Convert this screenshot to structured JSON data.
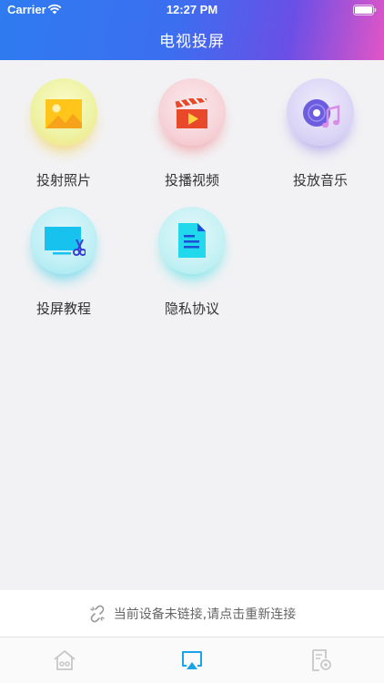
{
  "status_bar": {
    "carrier": "Carrier",
    "time": "12:27 PM"
  },
  "header": {
    "title": "电视投屏"
  },
  "colors": {
    "header_start": "#2f7bf0",
    "header_end": "#e255c6",
    "active_tab": "#1aa3e8",
    "inactive_tab": "#c8c8c8"
  },
  "tiles": [
    {
      "label": "投射照片",
      "icon": "image-icon"
    },
    {
      "label": "投播视频",
      "icon": "video-clapper-icon"
    },
    {
      "label": "投放音乐",
      "icon": "music-disc-icon"
    },
    {
      "label": "投屏教程",
      "icon": "screen-tutorial-icon"
    },
    {
      "label": "隐私协议",
      "icon": "document-icon"
    }
  ],
  "connection": {
    "message": "当前设备未链接,请点击重新连接",
    "icon": "broken-link-icon"
  },
  "tab_bar": {
    "tabs": [
      {
        "icon": "home-icon",
        "active": false
      },
      {
        "icon": "airplay-icon",
        "active": true
      },
      {
        "icon": "file-settings-icon",
        "active": false
      }
    ]
  }
}
